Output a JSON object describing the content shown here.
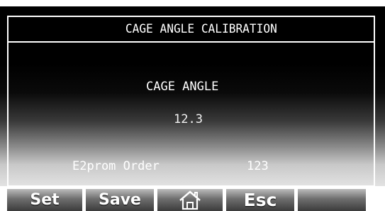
{
  "screen": {
    "title": "CAGE ANGLE CALIBRATION",
    "cage_angle_label": "CAGE ANGLE",
    "cage_angle_value": "12.3",
    "e2prom_order_label": "E2prom Order",
    "e2prom_order_value": "123"
  },
  "softkeys": {
    "set_label": "Set",
    "save_label": "Save",
    "home_icon": "home-icon",
    "esc_label": "Esc",
    "blank_label": ""
  },
  "colors": {
    "screen_background": "#000000",
    "text": "#ffffff",
    "softkey": "#6e6e6e"
  }
}
